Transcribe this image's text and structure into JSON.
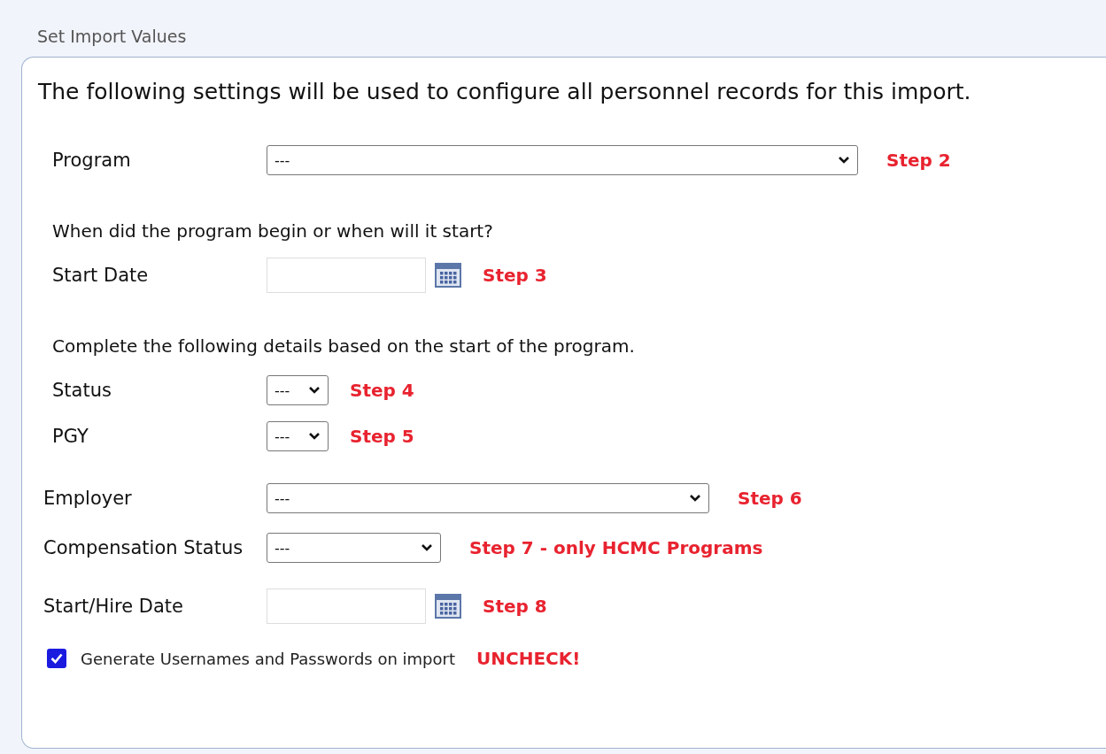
{
  "section_title": "Set Import Values",
  "intro": "The following settings will be used to configure all personnel records for this import.",
  "program_rows": [
    {
      "kind": "select",
      "label": "Program",
      "value": "---",
      "step": "Step 2"
    },
    {
      "kind": "note",
      "text": "When did the program begin or when will it start?"
    },
    {
      "kind": "date",
      "label": "Start Date",
      "step": "Step 3"
    },
    {
      "kind": "note",
      "text": "Complete the following details based on the start of the program."
    },
    {
      "kind": "select",
      "label": "Status",
      "value": "---",
      "step": "Step 4"
    },
    {
      "kind": "select",
      "label": "PGY",
      "value": "---",
      "step": "Step 5"
    }
  ],
  "employment_rows": [
    {
      "kind": "select",
      "label": "Employer",
      "value": "---",
      "step": "Step 6"
    },
    {
      "kind": "select",
      "label": "Compensation Status",
      "value": "---",
      "step": "Step 7 - only HCMC Programs"
    },
    {
      "kind": "date",
      "label": "Start/Hire Date",
      "step": "Step 8"
    }
  ],
  "checkbox": {
    "label": "Generate Usernames and Passwords on import",
    "checked": true,
    "note": "UNCHECK!"
  }
}
